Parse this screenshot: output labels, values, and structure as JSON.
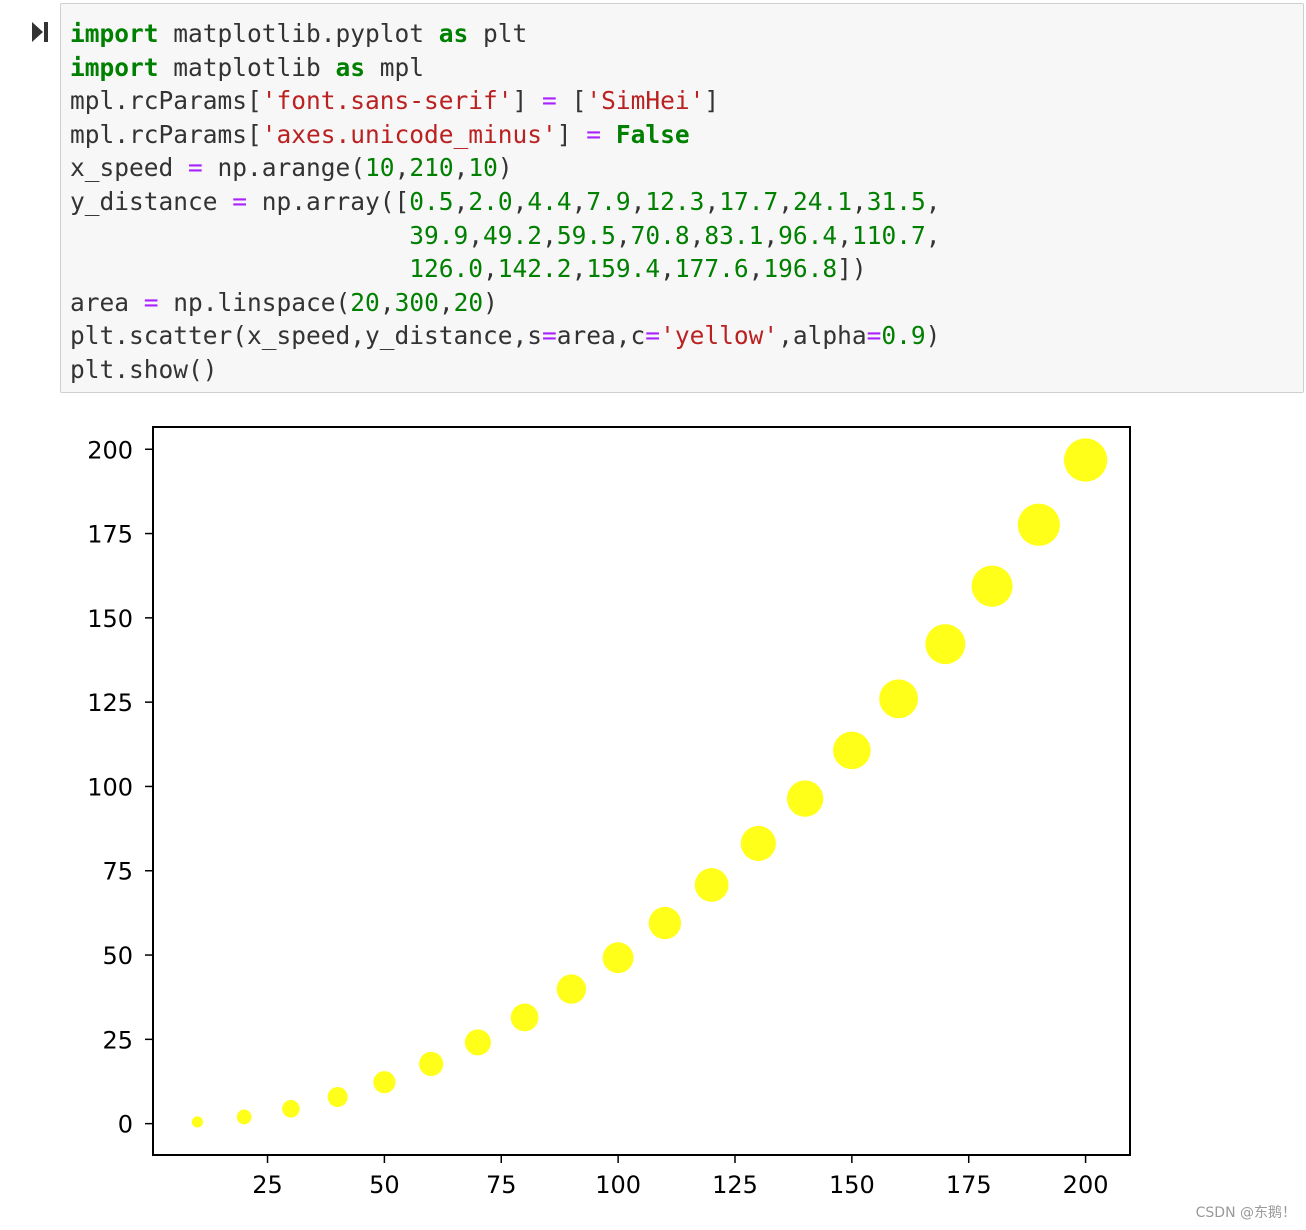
{
  "cell": {
    "run_icon": "run-cell-icon",
    "code_lines": [
      [
        {
          "t": "import",
          "c": "kw"
        },
        {
          "t": " matplotlib.pyplot "
        },
        {
          "t": "as",
          "c": "kw"
        },
        {
          "t": " plt"
        }
      ],
      [
        {
          "t": "import",
          "c": "kw"
        },
        {
          "t": " matplotlib "
        },
        {
          "t": "as",
          "c": "kw"
        },
        {
          "t": " mpl"
        }
      ],
      [
        {
          "t": "mpl.rcParams["
        },
        {
          "t": "'font.sans-serif'",
          "c": "str"
        },
        {
          "t": "] "
        },
        {
          "t": "=",
          "c": "op"
        },
        {
          "t": " ["
        },
        {
          "t": "'SimHei'",
          "c": "str"
        },
        {
          "t": "]"
        }
      ],
      [
        {
          "t": "mpl.rcParams["
        },
        {
          "t": "'axes.unicode_minus'",
          "c": "str"
        },
        {
          "t": "] "
        },
        {
          "t": "=",
          "c": "op"
        },
        {
          "t": " "
        },
        {
          "t": "False",
          "c": "kw"
        }
      ],
      [
        {
          "t": "x_speed "
        },
        {
          "t": "=",
          "c": "op"
        },
        {
          "t": " np.arange("
        },
        {
          "t": "10",
          "c": "num"
        },
        {
          "t": ","
        },
        {
          "t": "210",
          "c": "num"
        },
        {
          "t": ","
        },
        {
          "t": "10",
          "c": "num"
        },
        {
          "t": ")"
        }
      ],
      [
        {
          "t": "y_distance "
        },
        {
          "t": "=",
          "c": "op"
        },
        {
          "t": " np.array(["
        },
        {
          "t": "0.5",
          "c": "num"
        },
        {
          "t": ","
        },
        {
          "t": "2.0",
          "c": "num"
        },
        {
          "t": ","
        },
        {
          "t": "4.4",
          "c": "num"
        },
        {
          "t": ","
        },
        {
          "t": "7.9",
          "c": "num"
        },
        {
          "t": ","
        },
        {
          "t": "12.3",
          "c": "num"
        },
        {
          "t": ","
        },
        {
          "t": "17.7",
          "c": "num"
        },
        {
          "t": ","
        },
        {
          "t": "24.1",
          "c": "num"
        },
        {
          "t": ","
        },
        {
          "t": "31.5",
          "c": "num"
        },
        {
          "t": ","
        }
      ],
      [
        {
          "t": "                       "
        },
        {
          "t": "39.9",
          "c": "num"
        },
        {
          "t": ","
        },
        {
          "t": "49.2",
          "c": "num"
        },
        {
          "t": ","
        },
        {
          "t": "59.5",
          "c": "num"
        },
        {
          "t": ","
        },
        {
          "t": "70.8",
          "c": "num"
        },
        {
          "t": ","
        },
        {
          "t": "83.1",
          "c": "num"
        },
        {
          "t": ","
        },
        {
          "t": "96.4",
          "c": "num"
        },
        {
          "t": ","
        },
        {
          "t": "110.7",
          "c": "num"
        },
        {
          "t": ","
        }
      ],
      [
        {
          "t": "                       "
        },
        {
          "t": "126.0",
          "c": "num"
        },
        {
          "t": ","
        },
        {
          "t": "142.2",
          "c": "num"
        },
        {
          "t": ","
        },
        {
          "t": "159.4",
          "c": "num"
        },
        {
          "t": ","
        },
        {
          "t": "177.6",
          "c": "num"
        },
        {
          "t": ","
        },
        {
          "t": "196.8",
          "c": "num"
        },
        {
          "t": "])"
        }
      ],
      [
        {
          "t": "area "
        },
        {
          "t": "=",
          "c": "op"
        },
        {
          "t": " np.linspace("
        },
        {
          "t": "20",
          "c": "num"
        },
        {
          "t": ","
        },
        {
          "t": "300",
          "c": "num"
        },
        {
          "t": ","
        },
        {
          "t": "20",
          "c": "num"
        },
        {
          "t": ")"
        }
      ],
      [
        {
          "t": "plt.scatter(x_speed,y_distance,s"
        },
        {
          "t": "=",
          "c": "op"
        },
        {
          "t": "area,c"
        },
        {
          "t": "=",
          "c": "op"
        },
        {
          "t": "'yellow'",
          "c": "str"
        },
        {
          "t": ",alpha"
        },
        {
          "t": "=",
          "c": "op"
        },
        {
          "t": "0.9",
          "c": "num"
        },
        {
          "t": ")"
        }
      ],
      [
        {
          "t": "plt.show()"
        }
      ]
    ]
  },
  "chart_data": {
    "type": "scatter",
    "title": "",
    "xlabel": "",
    "ylabel": "",
    "x": [
      10,
      20,
      30,
      40,
      50,
      60,
      70,
      80,
      90,
      100,
      110,
      120,
      130,
      140,
      150,
      160,
      170,
      180,
      190,
      200
    ],
    "y": [
      0.5,
      2.0,
      4.4,
      7.9,
      12.3,
      17.7,
      24.1,
      31.5,
      39.9,
      49.2,
      59.5,
      70.8,
      83.1,
      96.4,
      110.7,
      126.0,
      142.2,
      159.4,
      177.6,
      196.8
    ],
    "sizes": [
      20,
      34.7,
      49.5,
      64.2,
      78.9,
      93.7,
      108.4,
      123.2,
      137.9,
      152.6,
      167.4,
      182.1,
      196.8,
      211.6,
      226.3,
      241.1,
      255.8,
      270.5,
      285.3,
      300
    ],
    "color": "#ffff00",
    "alpha": 0.9,
    "xlim": [
      0.5,
      209.5
    ],
    "ylim": [
      -9.3,
      206.6
    ],
    "xticks": [
      25,
      50,
      75,
      100,
      125,
      150,
      175,
      200
    ],
    "yticks": [
      0,
      25,
      50,
      75,
      100,
      125,
      150,
      175,
      200
    ],
    "grid": false,
    "legend": "none"
  },
  "watermark": "CSDN @东鹅！"
}
